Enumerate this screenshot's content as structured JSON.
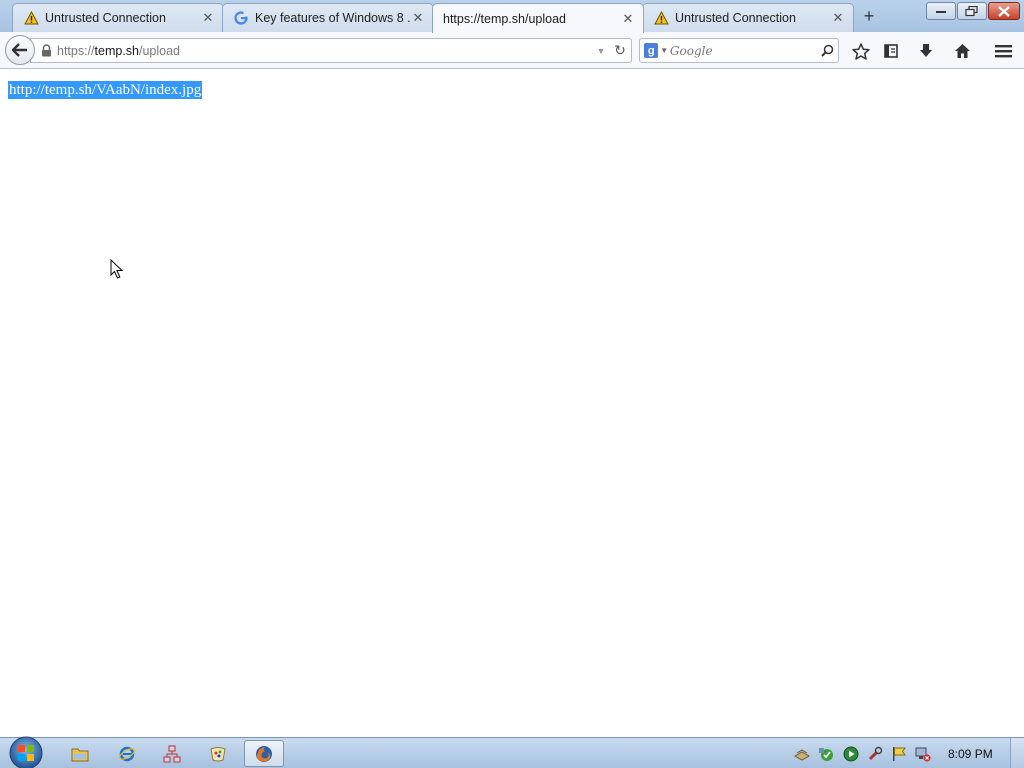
{
  "browser": {
    "tabs": [
      {
        "title": "Untrusted Connection",
        "icon": "warning-icon",
        "active": false
      },
      {
        "title": "Key features of Windows 8 ...",
        "icon": "google-icon",
        "active": false
      },
      {
        "title": "https://temp.sh/upload",
        "icon": "none",
        "active": true
      },
      {
        "title": "Untrusted Connection",
        "icon": "warning-icon",
        "active": false
      }
    ],
    "new_tab_label": "+",
    "url": {
      "scheme": "https://",
      "host": "temp.sh",
      "path": "/upload"
    },
    "search": {
      "engine": "g",
      "placeholder": "Google"
    }
  },
  "page": {
    "link_text": "http://temp.sh/VAabN/index.jpg",
    "selection_color": "#3399ff"
  },
  "taskbar": {
    "clock": "8:09 PM",
    "pinned": [
      "file-explorer-icon",
      "internet-explorer-icon",
      "network-icon",
      "paint-icon",
      "firefox-icon"
    ]
  }
}
